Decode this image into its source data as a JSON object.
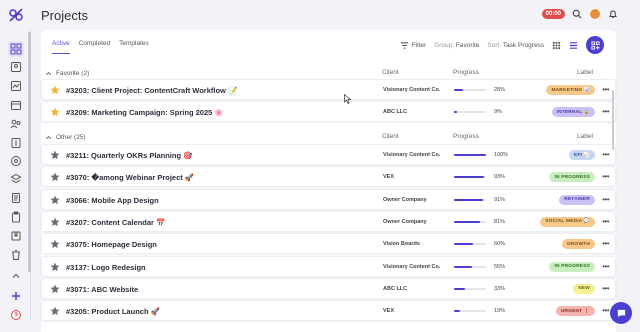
{
  "header": {
    "title": "Projects",
    "timer": "00:00"
  },
  "tabs": [
    {
      "label": "Active",
      "active": true
    },
    {
      "label": "Completed",
      "active": false
    },
    {
      "label": "Templates",
      "active": false
    }
  ],
  "toolbar": {
    "filter_label": "Filter",
    "group_prefix": "Group:",
    "group_value": "Favorite",
    "sort_prefix": "Sort:",
    "sort_value": "Task Progress"
  },
  "columns": {
    "client": "Client",
    "progress": "Progress",
    "label": "Label"
  },
  "sections": [
    {
      "title": "Favorite (2)",
      "rows": [
        {
          "name": "#3203: Client Project: ContentCraft Workflow 📝",
          "client": "Visionary Content Co.",
          "progress": 28,
          "progress_text": "28%",
          "label": "MARKETING 📊",
          "label_bg": "#f6c98a",
          "label_fg": "#7a4b10",
          "starred": true
        },
        {
          "name": "#3209: Marketing Campaign: Spring 2025 🌸",
          "client": "ABC LLC",
          "progress": 9,
          "progress_text": "9%",
          "label": "INTERNAL 🔒",
          "label_bg": "#c9c1f3",
          "label_fg": "#4a3aa8",
          "starred": true
        }
      ]
    },
    {
      "title": "Other (25)",
      "rows": [
        {
          "name": "#3211: Quarterly OKRs Planning 🎯",
          "client": "Visionary Content Co.",
          "progress": 100,
          "progress_text": "100%",
          "label": "KPI 📈",
          "label_bg": "#c7d6f6",
          "label_fg": "#2e4f9c",
          "starred": false
        },
        {
          "name": "#3070: �among Webinar Project 🚀",
          "client": "VEX",
          "progress": 93,
          "progress_text": "93%",
          "label": "IN PROGRESS",
          "label_bg": "#c9edbf",
          "label_fg": "#2f6e23",
          "starred": false
        },
        {
          "name": "#3066: Mobile App Design",
          "client": "Owner Company",
          "progress": 91,
          "progress_text": "91%",
          "label": "RETAINER",
          "label_bg": "#c9c1f3",
          "label_fg": "#4a3aa8",
          "starred": false
        },
        {
          "name": "#3207: Content Calendar 📅",
          "client": "Owner Company",
          "progress": 81,
          "progress_text": "81%",
          "label": "SOCIAL MEDIA 💬",
          "label_bg": "#f6c98a",
          "label_fg": "#7a4b10",
          "starred": false
        },
        {
          "name": "#3075: Homepage Design",
          "client": "Vision Boards",
          "progress": 60,
          "progress_text": "60%",
          "label": "GROWTH",
          "label_bg": "#f6c98a",
          "label_fg": "#7a4b10",
          "starred": false
        },
        {
          "name": "#3137: Logo Redesign",
          "client": "Visionary Content Co.",
          "progress": 55,
          "progress_text": "55%",
          "label": "IN PROGRESS",
          "label_bg": "#c9edbf",
          "label_fg": "#2f6e23",
          "starred": false
        },
        {
          "name": "#3071: ABC Website",
          "client": "ABC LLC",
          "progress": 33,
          "progress_text": "33%",
          "label": "NEW",
          "label_bg": "#f7ef94",
          "label_fg": "#6c6410",
          "starred": false
        },
        {
          "name": "#3205: Product Launch 🚀",
          "client": "VEX",
          "progress": 19,
          "progress_text": "19%",
          "label": "URGENT ❗",
          "label_bg": "#f6b4b0",
          "label_fg": "#8c2a22",
          "starred": false
        }
      ]
    }
  ],
  "colors": {
    "accent": "#4b3fd1",
    "star_favorite": "#f2b33d",
    "star_default": "#6b6b78"
  },
  "icons": {
    "sidebar": [
      "dashboard-icon",
      "contacts-icon",
      "reports-icon",
      "calendar-icon",
      "team-icon",
      "billing-icon",
      "settings-icon",
      "layers-icon",
      "documents-icon",
      "clipboard-icon",
      "bookmark-icon",
      "trash-icon"
    ]
  }
}
